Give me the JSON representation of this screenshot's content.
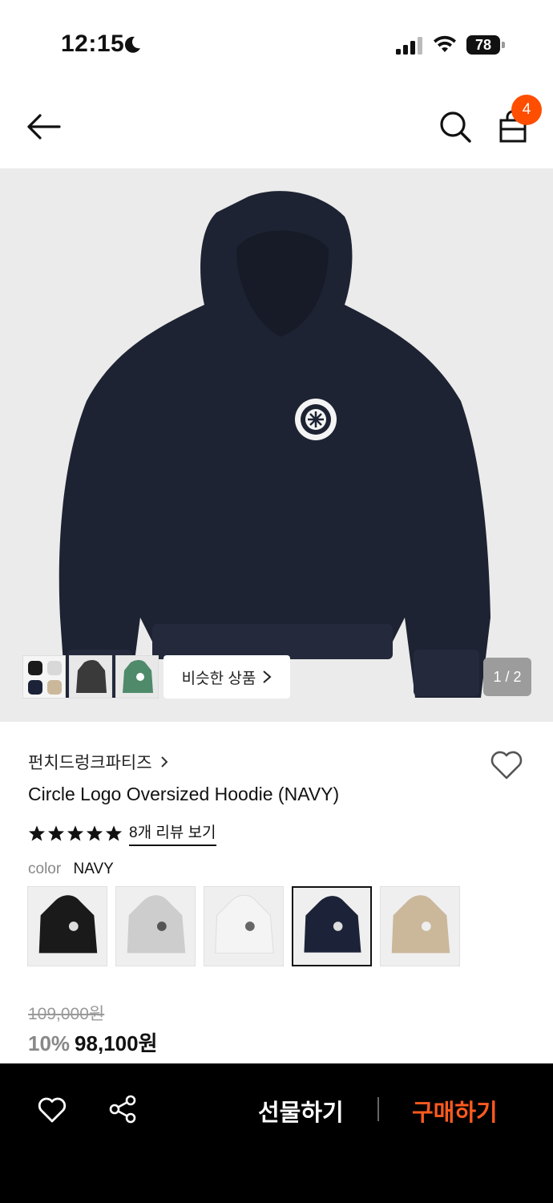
{
  "status_bar": {
    "time": "12:15",
    "battery": "78",
    "icons": [
      "moon-icon",
      "signal-icon",
      "wifi-icon",
      "battery-icon"
    ]
  },
  "nav": {
    "back_icon": "arrow-left-icon",
    "search_icon": "search-icon",
    "cart_icon": "shopping-bag-icon",
    "cart_count": "4",
    "badge_color": "#ff4e00"
  },
  "gallery": {
    "similar_label": "비슷한 상품",
    "page_indicator": "1 / 2"
  },
  "product": {
    "brand": "펀치드렁크파티즈",
    "title": "Circle Logo Oversized Hoodie (NAVY)",
    "rating_stars": 5,
    "review_link": "8개 리뷰 보기",
    "color_label": "color",
    "color_value": "NAVY",
    "swatches": [
      {
        "color": "#1a1a1a",
        "name": "black"
      },
      {
        "color": "#cfcfcf",
        "name": "grey"
      },
      {
        "color": "#ececec",
        "name": "white"
      },
      {
        "color": "#1c2338",
        "name": "navy",
        "selected": true
      },
      {
        "color": "#cbb79a",
        "name": "beige"
      }
    ],
    "original_price": "109,000원",
    "discount": "10%",
    "sale_price": "98,100원"
  },
  "bottom_bar": {
    "gift_label": "선물하기",
    "buy_label": "구매하기",
    "buy_color": "#ff5a1f"
  }
}
